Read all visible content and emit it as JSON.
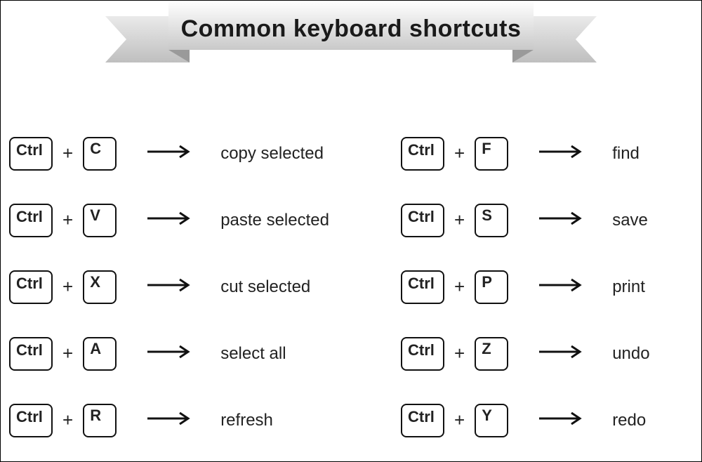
{
  "title": "Common keyboard shortcuts",
  "ctrl_label": "Ctrl",
  "plus_label": "+",
  "left": [
    {
      "key": "C",
      "action": "copy selected"
    },
    {
      "key": "V",
      "action": "paste selected"
    },
    {
      "key": "X",
      "action": "cut selected"
    },
    {
      "key": "A",
      "action": "select all"
    },
    {
      "key": "R",
      "action": "refresh"
    }
  ],
  "right": [
    {
      "key": "F",
      "action": "find"
    },
    {
      "key": "S",
      "action": "save"
    },
    {
      "key": "P",
      "action": "print"
    },
    {
      "key": "Z",
      "action": "undo"
    },
    {
      "key": "Y",
      "action": "redo"
    }
  ]
}
